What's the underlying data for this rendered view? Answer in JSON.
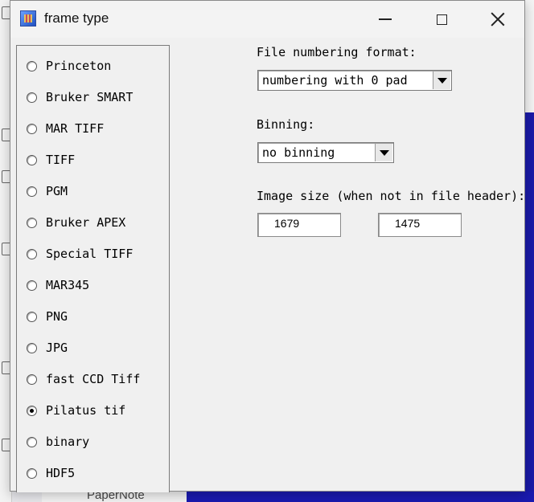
{
  "window": {
    "title": "frame type"
  },
  "frame_types": [
    {
      "label": "Princeton",
      "checked": false
    },
    {
      "label": "Bruker SMART",
      "checked": false
    },
    {
      "label": "MAR TIFF",
      "checked": false
    },
    {
      "label": "TIFF",
      "checked": false
    },
    {
      "label": "PGM",
      "checked": false
    },
    {
      "label": "Bruker APEX",
      "checked": false
    },
    {
      "label": "Special TIFF",
      "checked": false
    },
    {
      "label": "MAR345",
      "checked": false
    },
    {
      "label": "PNG",
      "checked": false
    },
    {
      "label": "JPG",
      "checked": false
    },
    {
      "label": "fast CCD Tiff",
      "checked": false
    },
    {
      "label": "Pilatus tif",
      "checked": true
    },
    {
      "label": "binary",
      "checked": false
    },
    {
      "label": "HDF5",
      "checked": false
    }
  ],
  "numbering": {
    "label": "File numbering format:",
    "value": "numbering with 0 pad"
  },
  "binning": {
    "label": "Binning:",
    "value": "no binning"
  },
  "image_size": {
    "label": "Image size (when not in file header):",
    "width": "1679",
    "height": "1475"
  },
  "background": {
    "bottom_text": "PaperNote"
  }
}
